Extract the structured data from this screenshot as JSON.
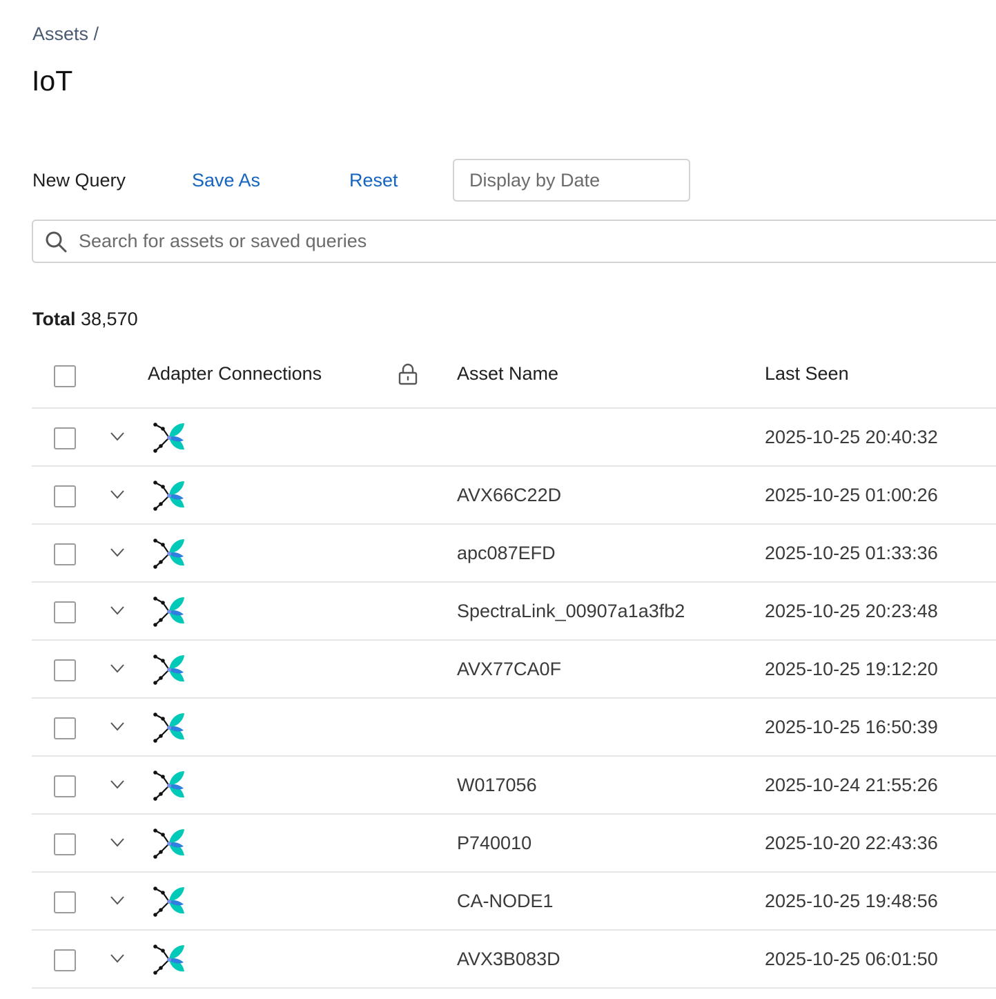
{
  "breadcrumb": "Assets /",
  "page_title": "IoT",
  "toolbar": {
    "new_query": "New Query",
    "save_as": "Save As",
    "reset": "Reset",
    "display_by_date": "Display by Date"
  },
  "search": {
    "placeholder": "Search for assets or saved queries",
    "value": ""
  },
  "total": {
    "label": "Total",
    "value": "38,570"
  },
  "table": {
    "columns": {
      "adapter": "Adapter Connections",
      "name": "Asset Name",
      "last_seen": "Last Seen"
    },
    "rows": [
      {
        "adapter_icon": "adapter-logo-icon",
        "name": "",
        "last_seen": "2025-10-25 20:40:32"
      },
      {
        "adapter_icon": "adapter-logo-icon",
        "name": "AVX66C22D",
        "last_seen": "2025-10-25 01:00:26"
      },
      {
        "adapter_icon": "adapter-logo-icon",
        "name": "apc087EFD",
        "last_seen": "2025-10-25 01:33:36"
      },
      {
        "adapter_icon": "adapter-logo-icon",
        "name": "SpectraLink_00907a1a3fb2",
        "last_seen": "2025-10-25 20:23:48"
      },
      {
        "adapter_icon": "adapter-logo-icon",
        "name": "AVX77CA0F",
        "last_seen": "2025-10-25 19:12:20"
      },
      {
        "adapter_icon": "adapter-logo-icon",
        "name": "",
        "last_seen": "2025-10-25 16:50:39"
      },
      {
        "adapter_icon": "adapter-logo-icon",
        "name": "W017056",
        "last_seen": "2025-10-24 21:55:26"
      },
      {
        "adapter_icon": "adapter-logo-icon",
        "name": "P740010",
        "last_seen": "2025-10-20 22:43:36"
      },
      {
        "adapter_icon": "adapter-logo-icon",
        "name": "CA-NODE1",
        "last_seen": "2025-10-25 19:48:56"
      },
      {
        "adapter_icon": "adapter-logo-icon",
        "name": "AVX3B083D",
        "last_seen": "2025-10-25 06:01:50"
      }
    ]
  },
  "colors": {
    "link": "#1565c0",
    "logo_teal": "#00c9b7",
    "logo_blue": "#2f7fe0",
    "border": "#d3d3d3"
  }
}
